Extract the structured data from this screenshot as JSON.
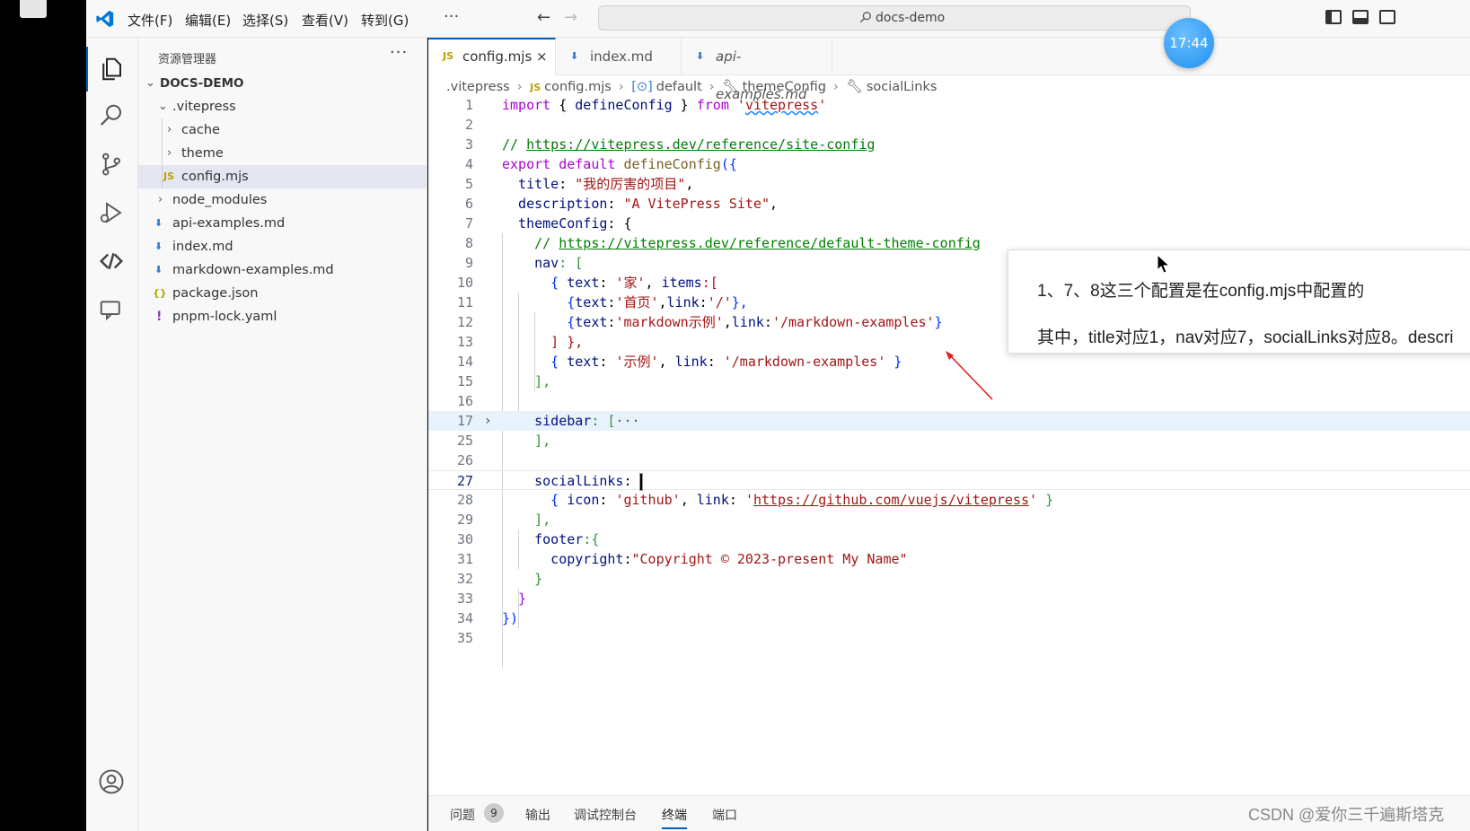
{
  "titlebar": {
    "menu": [
      "文件(F)",
      "编辑(E)",
      "选择(S)",
      "查看(V)",
      "转到(G)"
    ],
    "more": "···",
    "command_center": "docs-demo",
    "clock": "17:44"
  },
  "sidebar": {
    "title": "资源管理器",
    "more": "···",
    "root": "DOCS-DEMO",
    "items": [
      {
        "label": ".vitepress",
        "kind": "folder-open"
      },
      {
        "label": "cache",
        "kind": "folder"
      },
      {
        "label": "theme",
        "kind": "folder"
      },
      {
        "label": "config.mjs",
        "kind": "js",
        "icon_text": "JS"
      },
      {
        "label": "node_modules",
        "kind": "folder"
      },
      {
        "label": "api-examples.md",
        "kind": "md"
      },
      {
        "label": "index.md",
        "kind": "md"
      },
      {
        "label": "markdown-examples.md",
        "kind": "md"
      },
      {
        "label": "package.json",
        "kind": "json",
        "icon_text": "{}"
      },
      {
        "label": "pnpm-lock.yaml",
        "kind": "yaml",
        "icon_text": "!"
      }
    ]
  },
  "tabs": [
    {
      "label": "config.mjs",
      "icon_text": "JS",
      "close": "×"
    },
    {
      "label": "index.md"
    },
    {
      "label": "api-examples.md"
    }
  ],
  "breadcrumb": [
    ".vitepress",
    "config.mjs",
    "default",
    "themeConfig",
    "socialLinks"
  ],
  "breadcrumb_js": "JS",
  "code": {
    "line_numbers": [
      "1",
      "2",
      "3",
      "4",
      "5",
      "6",
      "7",
      "8",
      "9",
      "10",
      "11",
      "12",
      "13",
      "14",
      "15",
      "16",
      "17",
      "25",
      "26",
      "27",
      "28",
      "29",
      "30",
      "31",
      "32",
      "33",
      "34",
      "35"
    ],
    "l1": {
      "a": "import",
      "b": " { ",
      "c": "defineConfig",
      "d": " } ",
      "e": "from",
      "f": " '",
      "g": "vitepress",
      "h": "'"
    },
    "l3": {
      "a": "// ",
      "b": "https://vitepress.dev/reference/site-config"
    },
    "l4": {
      "a": "export default ",
      "b": "defineConfig",
      "c": "({"
    },
    "l5": {
      "a": "  title",
      "b": ": ",
      "c": "\"我的厉害的项目\"",
      "d": ","
    },
    "l6": {
      "a": "  description",
      "b": ": ",
      "c": "\"A VitePress Site\"",
      "d": ","
    },
    "l7": {
      "a": "  themeConfig",
      "b": ": {"
    },
    "l8": {
      "a": "    // ",
      "b": "https://vitepress.dev/reference/default-theme-config"
    },
    "l9": {
      "a": "    nav",
      "b": ": ["
    },
    "l10": {
      "a": "      { ",
      "b": "text",
      "c": ": ",
      "d": "'家'",
      "e": ", ",
      "f": "items",
      "g": ":["
    },
    "l11": {
      "a": "        {",
      "b": "text",
      "c": ":",
      "d": "'首页'",
      "e": ",",
      "f": "link",
      "g": ":",
      "h": "'/'",
      "i": "},"
    },
    "l12": {
      "a": "        {",
      "b": "text",
      "c": ":",
      "d": "'markdown示例'",
      "e": ",",
      "f": "link",
      "g": ":",
      "h": "'/markdown-examples'",
      "i": "}"
    },
    "l13": {
      "a": "      ] },"
    },
    "l14": {
      "a": "      { ",
      "b": "text",
      "c": ": ",
      "d": "'示例'",
      "e": ", ",
      "f": "link",
      "g": ": ",
      "h": "'/markdown-examples'",
      "i": " }"
    },
    "l15": {
      "a": "    ],"
    },
    "l17": {
      "a": "    sidebar",
      "b": ": [",
      "c": "···"
    },
    "l25": {
      "a": "    ],"
    },
    "l27": {
      "a": "    socialLinks",
      "b": ": "
    },
    "l28": {
      "a": "      { ",
      "b": "icon",
      "c": ": ",
      "d": "'github'",
      "e": ", ",
      "f": "link",
      "g": ": ",
      "h": "'",
      "i": "https://github.com/vuejs/vitepress",
      "j": "'",
      "k": " }"
    },
    "l29": {
      "a": "    ],"
    },
    "l30": {
      "a": "    footer",
      "b": ":{"
    },
    "l31": {
      "a": "      copyright",
      "b": ":",
      "c": "\"Copyright © 2023-present My Name\""
    },
    "l32": {
      "a": "    }"
    },
    "l33": {
      "a": "  }"
    },
    "l34": {
      "a": "})"
    }
  },
  "note": {
    "line1": "1、7、8这三个配置是在config.mjs中配置的",
    "line2": "其中，title对应1，nav对应7，socialLinks对应8。descri"
  },
  "panel": {
    "tabs": [
      "问题",
      "输出",
      "调试控制台",
      "终端",
      "端口"
    ],
    "problems_count": "9"
  },
  "watermark": "CSDN @爱你三千遍斯塔克",
  "colors": {
    "accent": "#005fb8",
    "keyword": "#af00db",
    "string": "#a31515",
    "comment": "#008000"
  }
}
